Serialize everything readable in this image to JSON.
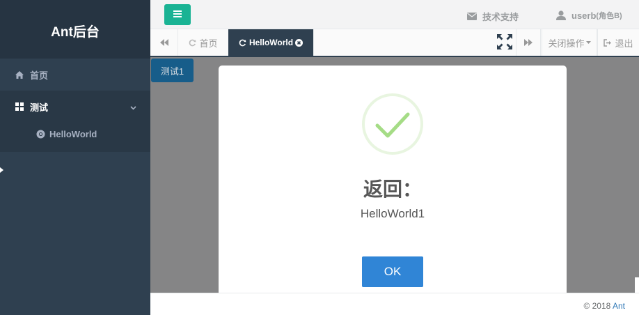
{
  "sidebar": {
    "brand": "Ant后台",
    "items": [
      {
        "label": "首页",
        "icon": "home-icon"
      },
      {
        "label": "测试",
        "icon": "grid-icon",
        "expanded": true,
        "children": [
          {
            "label": "HelloWorld",
            "icon": "chrome-icon"
          }
        ]
      }
    ]
  },
  "header": {
    "menu_icon": "bars-icon",
    "support_label": "技术支持",
    "user_name": "userb",
    "user_role": "(角色B)"
  },
  "tabs": {
    "items": [
      {
        "label": "首页",
        "icon": "refresh-icon",
        "active": false
      },
      {
        "label": "HelloWorld",
        "icon": "refresh-icon",
        "active": true,
        "closable": true
      }
    ],
    "close_ops_label": "关闭操作",
    "logout_label": "退出"
  },
  "content": {
    "button_label": "测试1"
  },
  "modal": {
    "icon": "success-check-icon",
    "title": "返回：",
    "text": "HelloWorld1",
    "ok_label": "OK"
  },
  "footer": {
    "copyright": "© 2018",
    "link": "Ant"
  },
  "colors": {
    "sidebar_bg": "#2f4050",
    "accent_green": "#1ab394",
    "button_blue": "#1c84c6",
    "ok_blue": "#3085d6",
    "success_green": "#a5dc86"
  }
}
